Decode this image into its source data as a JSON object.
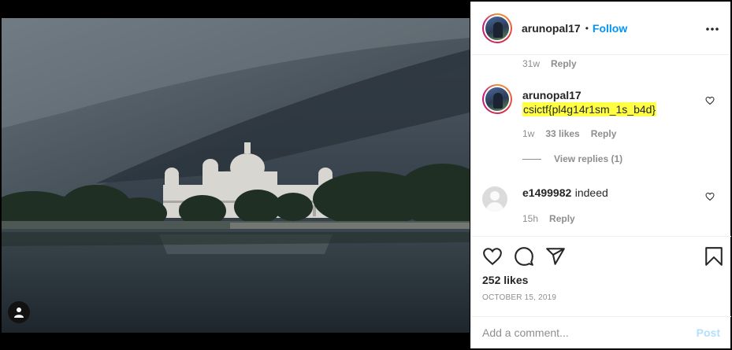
{
  "post": {
    "author": "arunopal17",
    "separator": "•",
    "follow_label": "Follow",
    "more_label": "•••"
  },
  "comments_section": {
    "previous_meta": {
      "age": "31w",
      "reply_label": "Reply"
    },
    "comments": [
      {
        "username": "arunopal17",
        "text": "csictf{pl4g14r1sm_1s_b4d}",
        "highlight_color": "#ffff44",
        "age": "1w",
        "likes": "33 likes",
        "reply_label": "Reply",
        "view_replies": "View replies (1)"
      },
      {
        "username": "e1499982",
        "text": "indeed",
        "age": "15h",
        "reply_label": "Reply"
      }
    ]
  },
  "actions": {
    "icons": [
      "heart-icon",
      "comment-icon",
      "share-icon",
      "bookmark-icon"
    ],
    "likes": "252 likes",
    "date": "OCTOBER 15, 2019"
  },
  "add_comment": {
    "placeholder": "Add a comment...",
    "post_label": "Post"
  },
  "colors": {
    "accent": "#0095f6",
    "post_disabled": "#b2dffc",
    "muted": "#8e8e8e"
  }
}
